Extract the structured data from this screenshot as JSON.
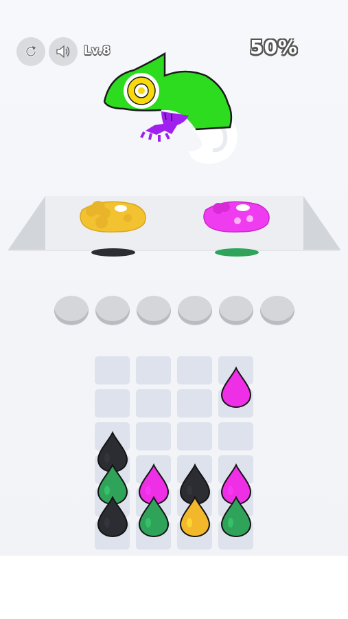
{
  "hud": {
    "restart_icon": "restart-icon",
    "sound_icon": "speaker-icon",
    "level_label": "Lv.8",
    "progress_text": "50%"
  },
  "artwork": {
    "subject": "chameleon",
    "colors": {
      "body": "#2ddc1e",
      "eye": "#f7d90c",
      "leg": "#a020f0"
    }
  },
  "palettes": [
    {
      "color": "yellow",
      "hex": "#f2c230"
    },
    {
      "color": "magenta",
      "hex": "#f03cf0"
    }
  ],
  "queue": {
    "slots": 6
  },
  "board": {
    "columns": [
      [
        "black",
        "green",
        "black"
      ],
      [
        "magenta",
        "green"
      ],
      [
        "black",
        "yellow"
      ],
      [
        "magenta",
        "green"
      ]
    ],
    "colors": {
      "black": "#2c2c33",
      "green": "#2fa35a",
      "magenta": "#ee2fe6",
      "yellow": "#f2b72a"
    }
  }
}
